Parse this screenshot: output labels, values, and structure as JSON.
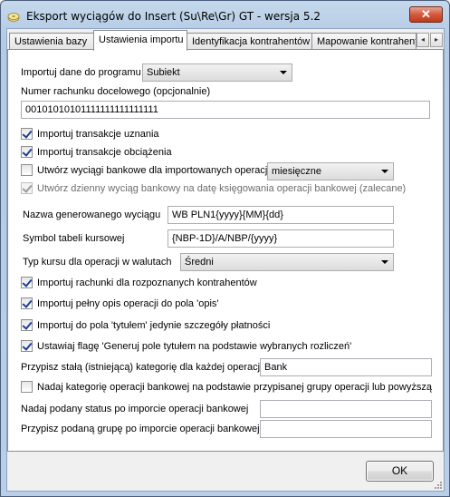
{
  "window": {
    "title": "Eksport wyciągów do Insert (Su\\Re\\Gr) GT - wersja 5.2",
    "close_symbol": "✕"
  },
  "tabs": [
    {
      "label": "Ustawienia bazy"
    },
    {
      "label": "Ustawienia importu"
    },
    {
      "label": "Identyfikacja kontrahentów"
    },
    {
      "label": "Mapowanie kontrahent"
    }
  ],
  "tab_scroll": {
    "left": "◂",
    "right": "▸"
  },
  "form": {
    "import_to_label": "Importuj dane do programu",
    "import_to_value": "Subiekt",
    "account_label": "Numer rachunku docelowego (opcjonalnie)",
    "account_value": "00101010101111111111111111",
    "chk_credit": {
      "label": "Importuj transakcje uznania",
      "checked": true
    },
    "chk_debit": {
      "label": "Importuj transakcje obciążenia",
      "checked": true
    },
    "chk_create_statements": {
      "label": "Utwórz wyciągi bankowe dla importowanych operacji",
      "checked": false
    },
    "period_value": "miesięczne",
    "chk_daily": {
      "label": "Utwórz dzienny wyciąg bankowy na datę księgowania operacji bankowej (zalecane)",
      "checked": true
    },
    "statement_name_label": "Nazwa generowanego wyciągu",
    "statement_name_value": "WB PLN1{yyyy}{MM}{dd}",
    "rate_table_label": "Symbol tabeli kursowej",
    "rate_table_value": "{NBP-1D}/A/NBP/{yyyy}",
    "rate_type_label": "Typ kursu dla operacji w walutach",
    "rate_type_value": "Średni",
    "chk_accounts": {
      "label": "Importuj rachunki dla rozpoznanych kontrahentów",
      "checked": true
    },
    "chk_full_desc": {
      "label": "Importuj pełny opis operacji do pola 'opis'",
      "checked": true
    },
    "chk_title_details": {
      "label": "Importuj do pola 'tytułem' jedynie szczegóły płatności",
      "checked": true
    },
    "chk_generate_title": {
      "label": "Ustawiaj flagę 'Generuj pole tytułem na podstawie wybranych rozliczeń'",
      "checked": true
    },
    "category_label": "Przypisz stałą (istniejącą) kategorię dla każdej operacji",
    "category_value": "Bank",
    "chk_category_group": {
      "label": "Nadaj kategorię operacji bankowej na podstawie przypisanej grupy operacji lub powyższą",
      "checked": false
    },
    "status_label": "Nadaj podany status po imporcie operacji bankowej",
    "status_value": "",
    "group_label": "Przypisz podaną grupę po imporcie operacji bankowej",
    "group_value": ""
  },
  "ok_label": "OK",
  "icons": {
    "app": "disk-icon",
    "close": "close-icon",
    "dropdown": "chevron-down-icon",
    "checkbox": "checkmark-icon",
    "grip": "resize-grip-icon"
  }
}
